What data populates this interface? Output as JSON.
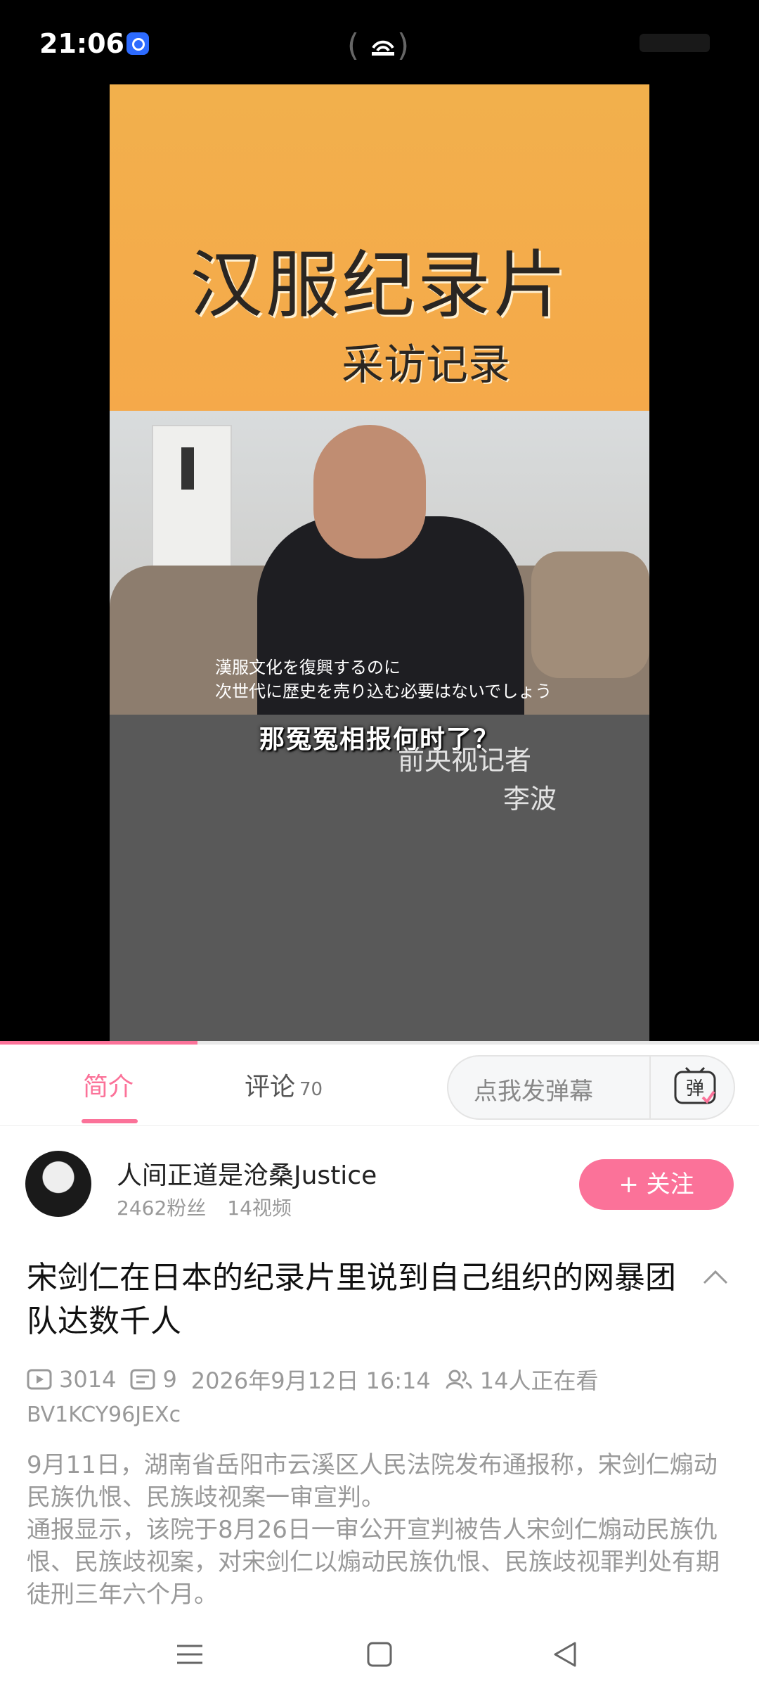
{
  "status_bar": {
    "time": "21:06"
  },
  "video": {
    "title_text": "汉服纪录片",
    "subtitle_text": "采访记录",
    "jp_subtitle_line1": "漢服文化を復興するのに",
    "jp_subtitle_line2": "次世代に歴史を売り込む必要はないでしょう",
    "cn_subtitle": "那冤冤相报何时了？",
    "credit_line1": "前央视记者",
    "credit_line2": "李波",
    "progress_fraction": 0.26
  },
  "tabs": {
    "intro_label": "简介",
    "comments_label": "评论",
    "comments_count": "70",
    "danmaku_placeholder": "点我发弹幕",
    "danmaku_icon_glyph": "弹"
  },
  "uploader": {
    "name": "人间正道是沧桑Justice",
    "fans": "2462粉丝",
    "videos": "14视频",
    "follow_label": "+ 关注"
  },
  "video_info": {
    "title": "宋剑仁在日本的纪录片里说到自己组织的网暴团队达数千人",
    "views": "3014",
    "danmaku_count": "9",
    "publish_time": "2026年9月12日 16:14",
    "watching": "14人正在看",
    "bvid": "BV1KCY96JEXc",
    "description_lines": [
      "9月11日，湖南省岳阳市云溪区人民法院发布通报称，宋剑仁煽动民族仇恨、民族歧视案一审宣判。",
      "通报显示，该院于8月26日一审公开宣判被告人宋剑仁煽动民族仇恨、民族歧视案，对宋剑仁以煽动民族仇恨、民族歧视罪判处有期徒刑三年六个月。"
    ]
  },
  "colors": {
    "accent": "#fb7299",
    "video_band": "#f5a94a"
  }
}
